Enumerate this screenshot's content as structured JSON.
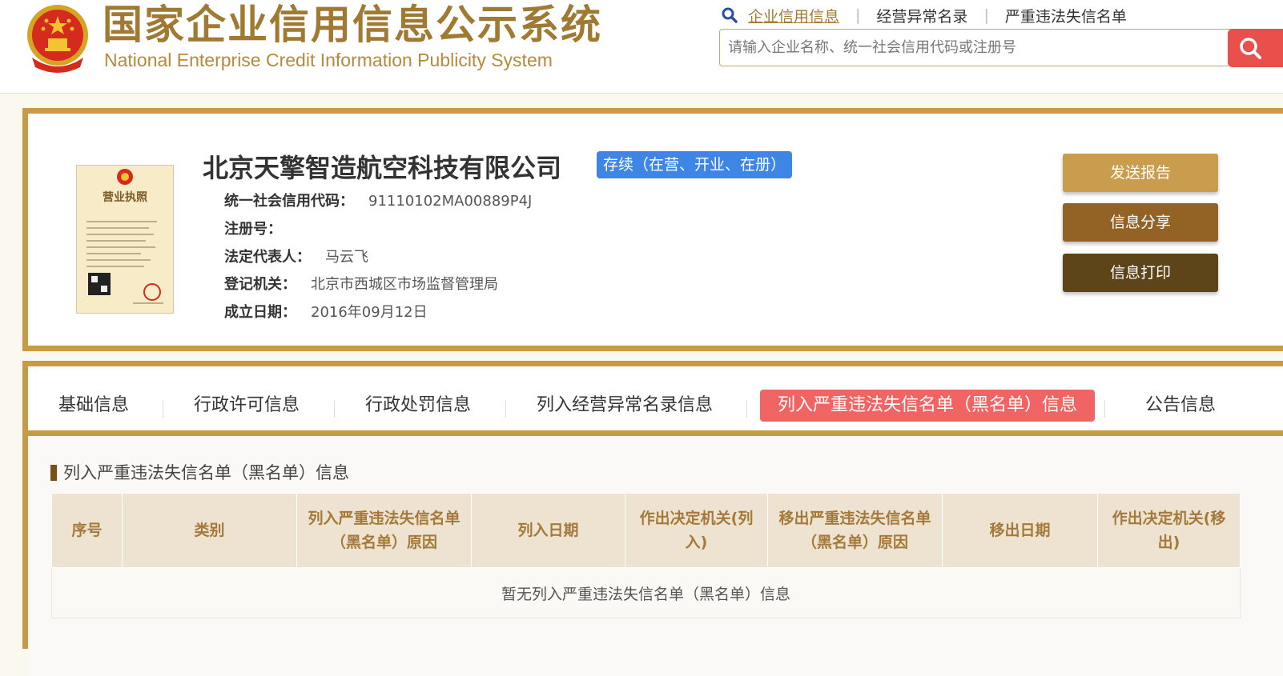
{
  "header": {
    "title_zh": "国家企业信用信息公示系统",
    "title_en": "National Enterprise Credit Information Publicity System",
    "nav": [
      {
        "label": "企业信用信息",
        "active": true
      },
      {
        "label": "经营异常名录",
        "active": false
      },
      {
        "label": "严重违法失信名单",
        "active": false
      }
    ],
    "search_placeholder": "请输入企业名称、统一社会信用代码或注册号"
  },
  "company": {
    "license_title": "营业执照",
    "name": "北京天擎智造航空科技有限公司",
    "status": "存续（在营、开业、在册）",
    "fields": [
      {
        "label": "统一社会信用代码：",
        "value": "91110102MA00889P4J"
      },
      {
        "label": "注册号：",
        "value": ""
      },
      {
        "label": "法定代表人：",
        "value": "马云飞"
      },
      {
        "label": "登记机关：",
        "value": "北京市西城区市场监督管理局"
      },
      {
        "label": "成立日期：",
        "value": "2016年09月12日"
      }
    ]
  },
  "actions": {
    "send_report": "发送报告",
    "share": "信息分享",
    "print": "信息打印"
  },
  "tabs": [
    {
      "label": "基础信息"
    },
    {
      "label": "行政许可信息"
    },
    {
      "label": "行政处罚信息"
    },
    {
      "label": "列入经营异常名录信息"
    },
    {
      "label": "列入严重违法失信名单（黑名单）信息",
      "active": true
    },
    {
      "label": "公告信息"
    }
  ],
  "section": {
    "title": "列入严重违法失信名单（黑名单）信息",
    "columns": [
      "序号",
      "类别",
      "列入严重违法失信名单（黑名单）原因",
      "列入日期",
      "作出决定机关(列入)",
      "移出严重违法失信名单（黑名单）原因",
      "移出日期",
      "作出决定机关(移出)"
    ],
    "empty_message": "暂无列入严重违法失信名单（黑名单）信息"
  },
  "colors": {
    "gold": "#c89a45",
    "brown_dark": "#5e4419",
    "brown_mid": "#936325",
    "gold_button": "#c99d4d",
    "active_tab": "#f06464",
    "status_blue": "#3d86e6",
    "search_red": "#e9504b"
  }
}
